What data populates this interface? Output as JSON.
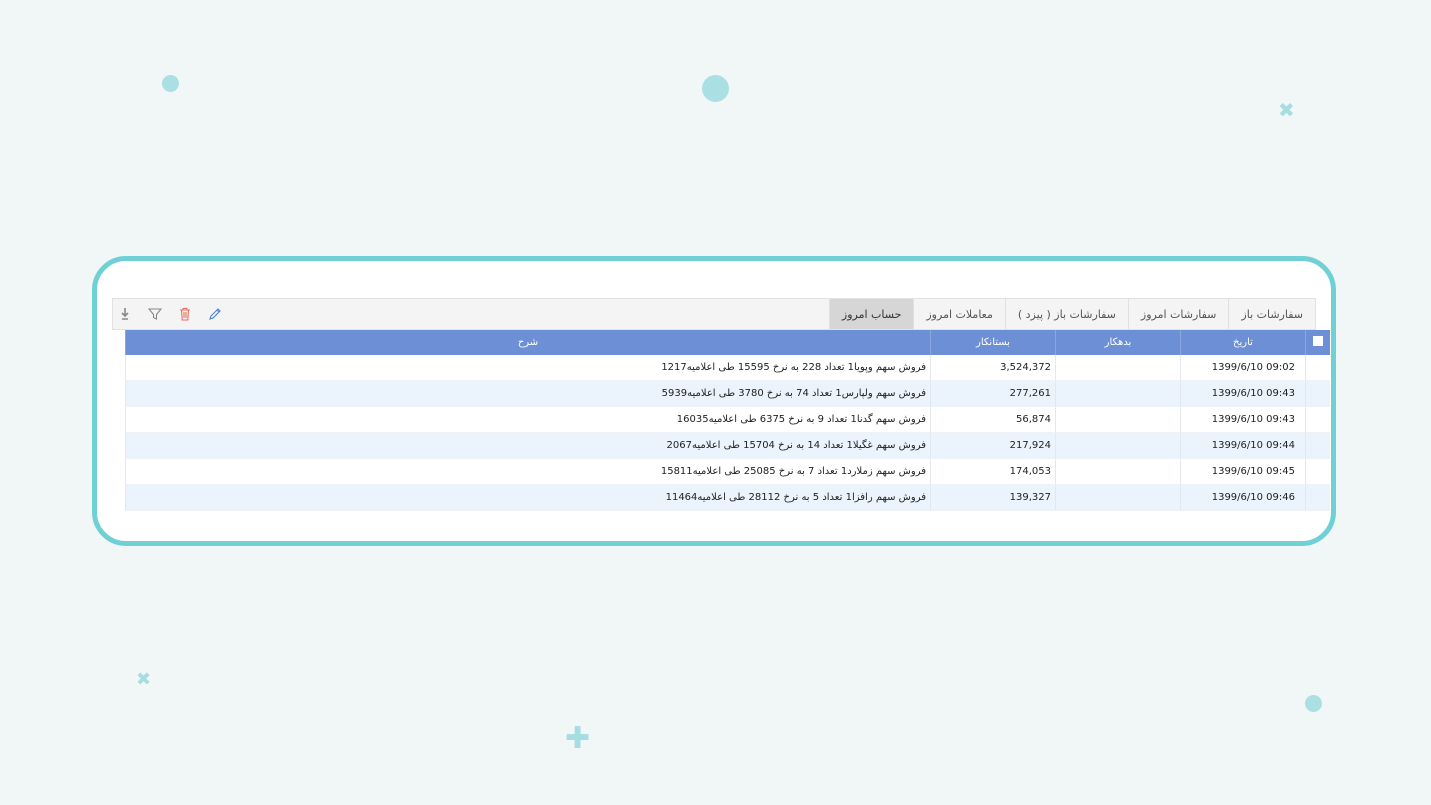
{
  "tabs": [
    {
      "label": "سفارشات باز",
      "active": false
    },
    {
      "label": "سفارشات امروز",
      "active": false
    },
    {
      "label": "سفارشات باز ( پیزد )",
      "active": false
    },
    {
      "label": "معاملات امروز",
      "active": false
    },
    {
      "label": "حساب امروز",
      "active": true
    }
  ],
  "toolbar_icons": [
    "edit-icon",
    "delete-icon",
    "filter-icon",
    "download-icon"
  ],
  "colors": {
    "accent": "#6c8fd5",
    "card_border": "#6fd0d6",
    "delete_icon": "#e8705a",
    "edit_icon": "#4a7fd4"
  },
  "table": {
    "headers": {
      "date": "تاریخ",
      "debit": "بدهکار",
      "credit": "بستانکار",
      "description": "شرح"
    },
    "rows": [
      {
        "date": "1399/6/10 09:02",
        "debit": "",
        "credit": "3,524,372",
        "description": "فروش سهم وپویا1 تعداد 228 به نرخ 15595 طی اعلامیه1217"
      },
      {
        "date": "1399/6/10 09:43",
        "debit": "",
        "credit": "277,261",
        "description": "فروش سهم ولپارس1 تعداد 74 به نرخ 3780 طی اعلامیه5939"
      },
      {
        "date": "1399/6/10 09:43",
        "debit": "",
        "credit": "56,874",
        "description": "فروش سهم گدنا1 تعداد 9 به نرخ 6375 طی اعلامیه16035"
      },
      {
        "date": "1399/6/10 09:44",
        "debit": "",
        "credit": "217,924",
        "description": "فروش سهم غگیلا1 تعداد 14 به نرخ 15704 طی اعلامیه2067"
      },
      {
        "date": "1399/6/10 09:45",
        "debit": "",
        "credit": "174,053",
        "description": "فروش سهم زملارد1 تعداد 7 به نرخ 25085 طی اعلامیه15811"
      },
      {
        "date": "1399/6/10 09:46",
        "debit": "",
        "credit": "139,327",
        "description": "فروش سهم رافزا1 تعداد 5 به نرخ 28112 طی اعلامیه11464"
      }
    ]
  }
}
